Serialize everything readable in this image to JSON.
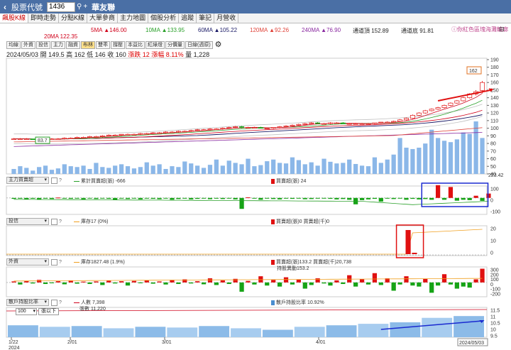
{
  "header": {
    "back_icon": "chevron-left-icon",
    "code_label": "股票代號",
    "code_value": "1436",
    "stock_name": "華友聯"
  },
  "tabs": [
    "飆股K線",
    "即時走勢",
    "分點K線",
    "大單參商",
    "主力地圖",
    "個股分析",
    "追蹤",
    "筆記",
    "月營收"
  ],
  "ma_bar": {
    "ma5": "5MA ▲146.00",
    "ma10": "10MA ▲133.95",
    "ma60": "60MA ▲105.22",
    "ma120": "120MA ▲92.26",
    "ma240": "240MA ▲76.90",
    "upper": "通道頂 152.89",
    "lower": "通道底 91.81",
    "ma20": "20MA 122.35",
    "link": "ⓘ你紅色區塊海灘輪廓"
  },
  "colors": {
    "ma5": "#d0021b",
    "ma10": "#2aa02a",
    "ma20": "#d0021b",
    "ma60": "#1a1a66",
    "ma120": "#e0443a",
    "ma240": "#8a2aa0",
    "up": "#e01010",
    "down": "#16a316",
    "vol": "#8bb7e8"
  },
  "toolbar": [
    "均線",
    "外資",
    "投信",
    "主力",
    "融資",
    "布林",
    "雙乖",
    "撐壓",
    "本益比",
    "紅綠燈",
    "分價量",
    "日線(週原)"
  ],
  "toolbar_active": "布林",
  "info": {
    "date": "2024/05/03",
    "open": "開 149.5",
    "high": "高 162",
    "low": "低 146",
    "close": "收 160",
    "change": "漲跌 12",
    "pct": "漲幅 8.11%",
    "vol": "量 1,228"
  },
  "price_chart": {
    "ylim": [
      40,
      190
    ],
    "yticks": [
      "190",
      "180",
      "170",
      "160",
      "150",
      "140",
      "130",
      "120",
      "110",
      "100",
      "90",
      "80",
      "70",
      "60",
      "50",
      "40"
    ],
    "last_price_tag": "162",
    "low_tag": "83.7",
    "candles": [
      [
        86,
        87,
        85,
        86
      ],
      [
        86,
        87,
        85,
        86
      ],
      [
        86,
        87,
        85,
        86
      ],
      [
        86,
        86,
        85,
        85
      ],
      [
        85,
        86,
        84,
        85
      ],
      [
        85,
        87,
        84,
        86
      ],
      [
        86,
        87,
        85,
        86
      ],
      [
        86,
        87,
        85,
        86
      ],
      [
        86,
        88,
        85,
        87
      ],
      [
        87,
        88,
        86,
        87
      ],
      [
        87,
        89,
        86,
        88
      ],
      [
        88,
        89,
        87,
        88
      ],
      [
        88,
        90,
        87,
        89
      ],
      [
        89,
        90,
        88,
        89
      ],
      [
        89,
        91,
        88,
        90
      ],
      [
        90,
        92,
        89,
        91
      ],
      [
        91,
        92,
        90,
        91
      ],
      [
        91,
        92,
        90,
        92
      ],
      [
        92,
        93,
        91,
        92
      ],
      [
        92,
        93,
        91,
        92
      ],
      [
        92,
        94,
        91,
        93
      ],
      [
        93,
        94,
        92,
        93
      ],
      [
        93,
        95,
        92,
        94
      ],
      [
        94,
        95,
        93,
        94
      ],
      [
        94,
        96,
        93,
        95
      ],
      [
        95,
        96,
        94,
        95
      ],
      [
        95,
        97,
        94,
        96
      ],
      [
        96,
        97,
        95,
        96
      ],
      [
        96,
        98,
        95,
        97
      ],
      [
        97,
        99,
        96,
        98
      ],
      [
        98,
        99,
        97,
        98
      ],
      [
        98,
        100,
        97,
        99
      ],
      [
        99,
        100,
        98,
        99
      ],
      [
        99,
        101,
        98,
        100
      ],
      [
        100,
        102,
        99,
        101
      ],
      [
        101,
        103,
        100,
        102
      ],
      [
        102,
        103,
        100,
        101
      ],
      [
        101,
        102,
        100,
        101
      ],
      [
        101,
        102,
        100,
        101
      ],
      [
        101,
        102,
        100,
        100
      ],
      [
        100,
        101,
        99,
        100
      ],
      [
        100,
        101,
        99,
        101
      ],
      [
        101,
        103,
        100,
        102
      ],
      [
        102,
        104,
        101,
        103
      ],
      [
        103,
        105,
        102,
        104
      ],
      [
        104,
        106,
        103,
        105
      ],
      [
        105,
        107,
        104,
        106
      ],
      [
        106,
        108,
        105,
        107
      ],
      [
        107,
        108,
        106,
        106
      ],
      [
        106,
        107,
        105,
        106
      ],
      [
        106,
        108,
        105,
        107
      ],
      [
        107,
        108,
        106,
        107
      ],
      [
        107,
        108,
        106,
        106
      ],
      [
        106,
        107,
        105,
        106
      ],
      [
        106,
        107,
        105,
        106
      ],
      [
        106,
        107,
        105,
        106
      ],
      [
        106,
        107,
        105,
        106
      ],
      [
        106,
        107,
        105,
        107
      ],
      [
        107,
        108,
        106,
        108
      ],
      [
        108,
        109,
        107,
        108
      ],
      [
        108,
        110,
        107,
        109
      ],
      [
        109,
        112,
        108,
        111
      ],
      [
        111,
        114,
        110,
        113
      ],
      [
        113,
        118,
        112,
        117
      ],
      [
        117,
        121,
        116,
        120
      ],
      [
        120,
        124,
        119,
        123
      ],
      [
        123,
        126,
        122,
        125
      ],
      [
        125,
        128,
        124,
        127
      ],
      [
        127,
        131,
        126,
        130
      ],
      [
        130,
        134,
        129,
        133
      ],
      [
        133,
        137,
        132,
        136
      ],
      [
        136,
        141,
        135,
        140
      ],
      [
        140,
        146,
        139,
        145
      ],
      [
        145,
        150,
        143,
        148
      ],
      [
        149.5,
        162,
        146,
        160
      ]
    ],
    "volumes": [
      18,
      28,
      22,
      12,
      25,
      30,
      15,
      20,
      35,
      28,
      25,
      30,
      18,
      40,
      25,
      22,
      30,
      35,
      28,
      20,
      25,
      42,
      30,
      35,
      18,
      28,
      25,
      45,
      38,
      30,
      22,
      33,
      52,
      30,
      48,
      40,
      35,
      55,
      28,
      32,
      46,
      52,
      40,
      38,
      60,
      50,
      35,
      42,
      30,
      55,
      44,
      38,
      40,
      52,
      36,
      30,
      28,
      60,
      40,
      52,
      70,
      130,
      95,
      90,
      95,
      110,
      160,
      130,
      120,
      115,
      125,
      150,
      145,
      190,
      130
    ]
  },
  "panel_main_force": {
    "select": "主力買賣超",
    "note1": "累計買賣超(張) -666",
    "note2": "買賣超(張) 24",
    "right_value": "223.42",
    "yticks": [
      "100",
      "0",
      "-100"
    ],
    "bars": [
      -5,
      -3,
      -8,
      -2,
      -10,
      -4,
      -6,
      2,
      -3,
      -5,
      -4,
      -8,
      -2,
      -6,
      -3,
      -5,
      -12,
      -4,
      -6,
      -3,
      -8,
      -2,
      -5,
      -7,
      -3,
      -10,
      -6,
      -4,
      -8,
      -5,
      -3,
      -7,
      -4,
      -6,
      -2,
      -8,
      -60,
      3,
      -4,
      -10,
      -3,
      -6,
      -8,
      -4,
      -5,
      -3,
      -7,
      -6,
      -4,
      -2,
      -5,
      -8,
      -6,
      -10,
      -35,
      -12,
      -8,
      -5,
      -20,
      -4,
      -6,
      -3,
      -10,
      -5,
      -8,
      -6,
      -10,
      70,
      -10,
      60,
      -15,
      -10,
      -12,
      12,
      -16,
      24
    ]
  },
  "panel_trust": {
    "select": "投信",
    "note1": "庫存17 (0%)",
    "note2": "買賣超(張)0 買賣超(千)0",
    "yticks": [
      "20",
      "10",
      "0"
    ]
  },
  "panel_foreign": {
    "select": "外資",
    "note1": "庫存1827.48 (1.9%)",
    "note2": "買賣超(張)133.2 買賣超(千)20,738",
    "note3": "持股異動153.2",
    "yticks": [
      "300",
      "200",
      "100",
      "0",
      "-100",
      "-200"
    ],
    "bars": [
      10,
      -20,
      15,
      -10,
      25,
      -15,
      -8,
      12,
      -18,
      20,
      -12,
      8,
      -15,
      10,
      -25,
      18,
      -10,
      12,
      -30,
      15,
      -8,
      20,
      -12,
      10,
      -20,
      25,
      -15,
      30,
      -10,
      12,
      -18,
      40,
      -25,
      20,
      -15,
      35,
      -90,
      15,
      -20,
      60,
      -30,
      25,
      -40,
      50,
      -20,
      30,
      -60,
      -25,
      40,
      -10,
      -30,
      20,
      -15,
      70,
      -40,
      30,
      -20,
      90,
      -25,
      40,
      -80,
      -20,
      60,
      -30,
      -40,
      35,
      -100,
      -30,
      80,
      -20,
      -60,
      -40,
      -50,
      30,
      133
    ]
  },
  "panel_holders": {
    "select": "散戶持股比率",
    "note1": "人數 7,398",
    "note2": "張數 11,220",
    "note3": "散戶持股比率 10.92%",
    "dropdown": "100",
    "dropdown_btn": "張以下",
    "yticks": [
      "11.5",
      "11",
      "10.5",
      "10",
      "9.5"
    ]
  },
  "x_axis": {
    "labels": [
      "1/22",
      "2/01",
      "3/01",
      "4/01"
    ],
    "year": "2024",
    "end_tag": "2024/05/03"
  }
}
